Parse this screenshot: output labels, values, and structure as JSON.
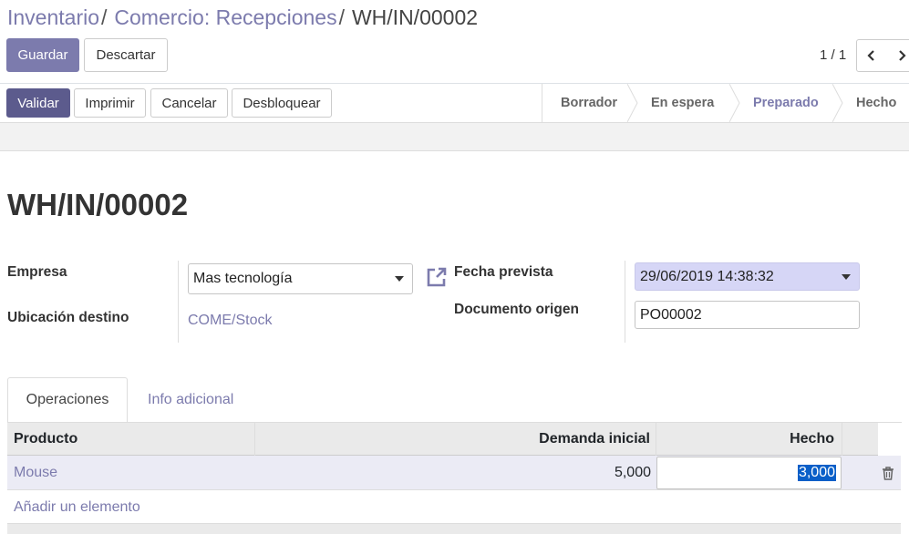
{
  "breadcrumb": {
    "items": [
      "Inventario",
      "Comercio: Recepciones"
    ],
    "separator": "/",
    "current": "WH/IN/00002"
  },
  "toolbar": {
    "save_label": "Guardar",
    "discard_label": "Descartar"
  },
  "pager": {
    "value": "1 / 1"
  },
  "actions": {
    "validate_label": "Validar",
    "print_label": "Imprimir",
    "cancel_label": "Cancelar",
    "unlock_label": "Desbloquear"
  },
  "statusbar": {
    "stages": [
      "Borrador",
      "En espera",
      "Preparado",
      "Hecho"
    ],
    "active": "Preparado"
  },
  "record": {
    "name": "WH/IN/00002",
    "partner_label": "Empresa",
    "partner_value": "Mas tecnología",
    "dest_label": "Ubicación destino",
    "dest_value": "COME/Stock",
    "date_label": "Fecha prevista",
    "date_value": "29/06/2019 14:38:32",
    "origin_label": "Documento origen",
    "origin_value": "PO00002"
  },
  "tabs": [
    "Operaciones",
    "Info adicional"
  ],
  "operations": {
    "columns": [
      "Producto",
      "Demanda inicial",
      "Hecho"
    ],
    "rows": [
      {
        "product": "Mouse",
        "demand": "5,000",
        "done": "3,000"
      }
    ],
    "add_label": "Añadir un elemento"
  },
  "colors": {
    "brand": "#7c7bad",
    "brand_dark": "#5c5b8d",
    "date_field": "#d6d6f6"
  },
  "icons": [
    "chevron-left-icon",
    "chevron-right-icon",
    "external-link-icon",
    "caret-down-icon",
    "trash-icon"
  ]
}
